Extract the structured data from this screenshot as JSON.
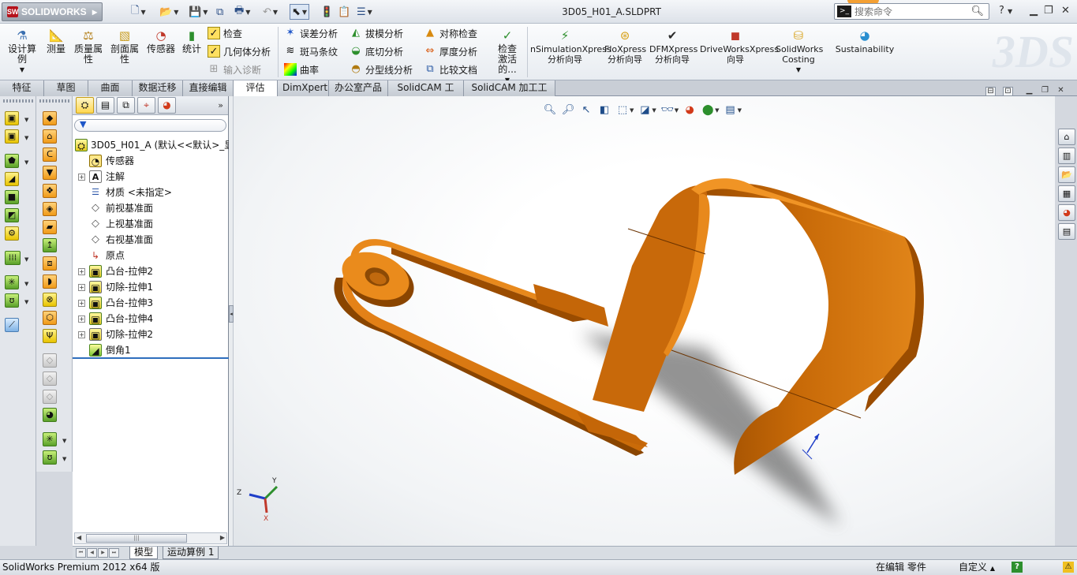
{
  "titlebar": {
    "logo_text": "SOLIDWORKS",
    "doc_title": "3D05_H01_A.SLDPRT",
    "search_placeholder": "搜索命令",
    "help_label": "?"
  },
  "ribbon": {
    "large": [
      {
        "label": "设计算例",
        "icon": "design-study-icon"
      },
      {
        "label": "测量",
        "icon": "measure-icon"
      },
      {
        "label": "质量属性",
        "icon": "mass-properties-icon"
      },
      {
        "label": "剖面属性",
        "icon": "section-properties-icon"
      },
      {
        "label": "传感器",
        "icon": "sensor-icon"
      },
      {
        "label": "统计",
        "icon": "statistics-icon"
      }
    ],
    "check_col": [
      {
        "label": "检查",
        "icon": "check-icon"
      },
      {
        "label": "几何体分析",
        "icon": "geometry-analysis-icon"
      },
      {
        "label": "输入诊断",
        "icon": "import-diagnostics-icon"
      }
    ],
    "analysis_col1": [
      {
        "label": "误差分析",
        "icon": "deviation-analysis-icon"
      },
      {
        "label": "斑马条纹",
        "icon": "zebra-stripes-icon"
      },
      {
        "label": "曲率",
        "icon": "curvature-icon"
      }
    ],
    "analysis_col2": [
      {
        "label": "拔模分析",
        "icon": "draft-analysis-icon"
      },
      {
        "label": "底切分析",
        "icon": "undercut-analysis-icon"
      },
      {
        "label": "分型线分析",
        "icon": "parting-line-analysis-icon"
      }
    ],
    "analysis_col3": [
      {
        "label": "对称检查",
        "icon": "symmetry-check-icon"
      },
      {
        "label": "厚度分析",
        "icon": "thickness-analysis-icon"
      },
      {
        "label": "比较文档",
        "icon": "compare-documents-icon"
      }
    ],
    "check_active": "检查激活的...",
    "xpress": [
      {
        "label": "nSimulationXpress 分析向导",
        "icon": "simulationxpress-icon"
      },
      {
        "label": "FloXpress 分析向导",
        "icon": "floxpress-icon"
      },
      {
        "label": "DFMXpress 分析向导",
        "icon": "dfmxpress-icon"
      },
      {
        "label": "DriveWorksXpress 向导",
        "icon": "driveworksxpress-icon"
      },
      {
        "label": "SolidWorks Costing",
        "icon": "costing-icon"
      },
      {
        "label": "Sustainability",
        "icon": "sustainability-icon"
      }
    ]
  },
  "tabs": [
    "特征",
    "草图",
    "曲面",
    "数据迁移",
    "直接编辑",
    "评估",
    "DimXpert",
    "办公室产品",
    "SolidCAM 工件",
    "SolidCAM 加工工程"
  ],
  "active_tab": "评估",
  "tree": {
    "root": "3D05_H01_A  (默认<<默认>_显",
    "items": [
      {
        "label": "传感器",
        "icon": "sensor-icon",
        "expand": false
      },
      {
        "label": "注解",
        "icon": "annotations-icon",
        "expand": true
      },
      {
        "label": "材质 <未指定>",
        "icon": "material-icon",
        "expand": false
      },
      {
        "label": "前视基准面",
        "icon": "plane-icon",
        "expand": false
      },
      {
        "label": "上视基准面",
        "icon": "plane-icon",
        "expand": false
      },
      {
        "label": "右视基准面",
        "icon": "plane-icon",
        "expand": false
      },
      {
        "label": "原点",
        "icon": "origin-icon",
        "expand": false
      },
      {
        "label": "凸台-拉伸2",
        "icon": "boss-extrude-icon",
        "expand": true
      },
      {
        "label": "切除-拉伸1",
        "icon": "cut-extrude-icon",
        "expand": true
      },
      {
        "label": "凸台-拉伸3",
        "icon": "boss-extrude-icon",
        "expand": true
      },
      {
        "label": "凸台-拉伸4",
        "icon": "boss-extrude-icon",
        "expand": true
      },
      {
        "label": "切除-拉伸2",
        "icon": "cut-extrude-icon",
        "expand": true
      },
      {
        "label": "倒角1",
        "icon": "chamfer-icon",
        "expand": false
      }
    ]
  },
  "bottom_tabs": [
    "模型",
    "运动算例 1"
  ],
  "status": {
    "left": "SolidWorks Premium 2012 x64 版",
    "editing": "在编辑 零件",
    "custom": "自定义"
  },
  "triad": {
    "x": "X",
    "y": "Y",
    "z": "Z"
  },
  "colors": {
    "part": "#d2730c",
    "part_dark": "#8a4500",
    "accent": "#2f6ebd"
  }
}
